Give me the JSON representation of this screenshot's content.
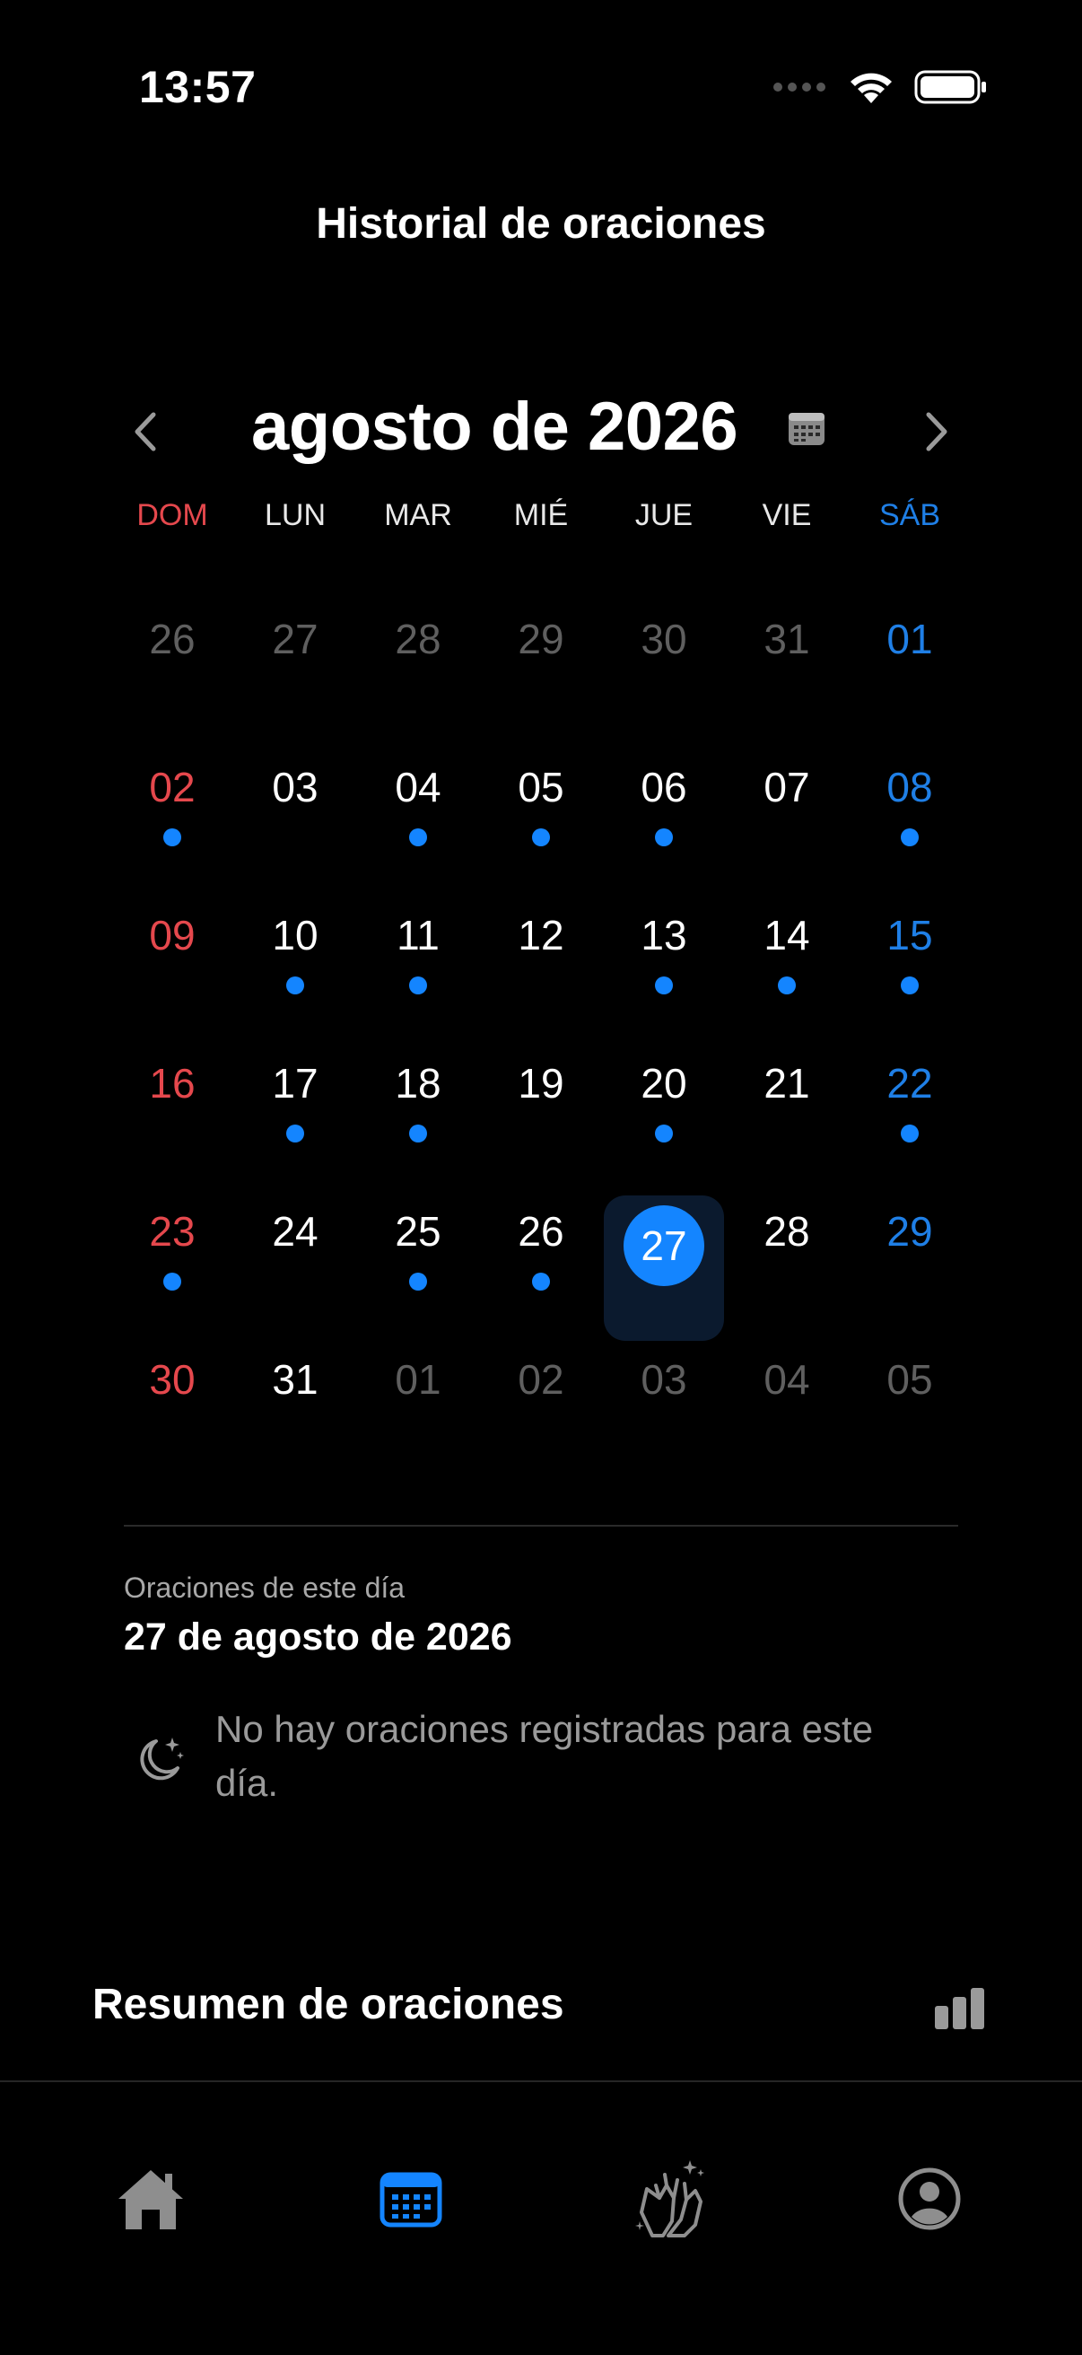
{
  "status_bar": {
    "time": "13:57"
  },
  "header": {
    "title": "Historial de oraciones"
  },
  "calendar": {
    "month_label": "agosto de 2026",
    "weekdays": [
      {
        "label": "DOM",
        "color": "#e5484d"
      },
      {
        "label": "LUN",
        "color": "#e8e8e8"
      },
      {
        "label": "MAR",
        "color": "#e8e8e8"
      },
      {
        "label": "MIÉ",
        "color": "#e8e8e8"
      },
      {
        "label": "JUE",
        "color": "#e8e8e8"
      },
      {
        "label": "VIE",
        "color": "#e8e8e8"
      },
      {
        "label": "SÁB",
        "color": "#1f7fe6"
      }
    ],
    "weeks": [
      [
        {
          "d": "26",
          "m": "out"
        },
        {
          "d": "27",
          "m": "out"
        },
        {
          "d": "28",
          "m": "out"
        },
        {
          "d": "29",
          "m": "out"
        },
        {
          "d": "30",
          "m": "out"
        },
        {
          "d": "31",
          "m": "out"
        },
        {
          "d": "01",
          "m": "in",
          "dot": false
        }
      ],
      [
        {
          "d": "02",
          "m": "in",
          "dot": true
        },
        {
          "d": "03",
          "m": "in",
          "dot": false
        },
        {
          "d": "04",
          "m": "in",
          "dot": true
        },
        {
          "d": "05",
          "m": "in",
          "dot": true
        },
        {
          "d": "06",
          "m": "in",
          "dot": true
        },
        {
          "d": "07",
          "m": "in",
          "dot": false
        },
        {
          "d": "08",
          "m": "in",
          "dot": true
        }
      ],
      [
        {
          "d": "09",
          "m": "in",
          "dot": false
        },
        {
          "d": "10",
          "m": "in",
          "dot": true
        },
        {
          "d": "11",
          "m": "in",
          "dot": true
        },
        {
          "d": "12",
          "m": "in",
          "dot": false
        },
        {
          "d": "13",
          "m": "in",
          "dot": true
        },
        {
          "d": "14",
          "m": "in",
          "dot": true
        },
        {
          "d": "15",
          "m": "in",
          "dot": true
        }
      ],
      [
        {
          "d": "16",
          "m": "in",
          "dot": false
        },
        {
          "d": "17",
          "m": "in",
          "dot": true
        },
        {
          "d": "18",
          "m": "in",
          "dot": true
        },
        {
          "d": "19",
          "m": "in",
          "dot": false
        },
        {
          "d": "20",
          "m": "in",
          "dot": true
        },
        {
          "d": "21",
          "m": "in",
          "dot": false
        },
        {
          "d": "22",
          "m": "in",
          "dot": true
        }
      ],
      [
        {
          "d": "23",
          "m": "in",
          "dot": true
        },
        {
          "d": "24",
          "m": "in",
          "dot": false
        },
        {
          "d": "25",
          "m": "in",
          "dot": true
        },
        {
          "d": "26",
          "m": "in",
          "dot": true
        },
        {
          "d": "27",
          "m": "in",
          "dot": false,
          "selected": true
        },
        {
          "d": "28",
          "m": "in",
          "dot": false
        },
        {
          "d": "29",
          "m": "in",
          "dot": false
        }
      ],
      [
        {
          "d": "30",
          "m": "in",
          "dot": false
        },
        {
          "d": "31",
          "m": "in",
          "dot": false
        },
        {
          "d": "01",
          "m": "out"
        },
        {
          "d": "02",
          "m": "out"
        },
        {
          "d": "03",
          "m": "out"
        },
        {
          "d": "04",
          "m": "out"
        },
        {
          "d": "05",
          "m": "out"
        }
      ]
    ],
    "colors": {
      "sunday": "#e5484d",
      "saturday": "#1f7fe6",
      "weekday": "#ffffff",
      "outside": "#5f5f5f",
      "accent": "#1485ff"
    }
  },
  "day_detail": {
    "subtitle": "Oraciones de este día",
    "date": "27 de agosto de 2026",
    "empty_message": "No hay oraciones registradas para este día."
  },
  "summary": {
    "title": "Resumen de oraciones"
  },
  "tab_bar": {
    "tabs": [
      {
        "name": "home",
        "icon": "house-icon",
        "active": false
      },
      {
        "name": "calendar",
        "icon": "calendar-icon",
        "active": true
      },
      {
        "name": "prayer",
        "icon": "praying-hands-icon",
        "active": false
      },
      {
        "name": "profile",
        "icon": "person-circle-icon",
        "active": false
      }
    ]
  }
}
